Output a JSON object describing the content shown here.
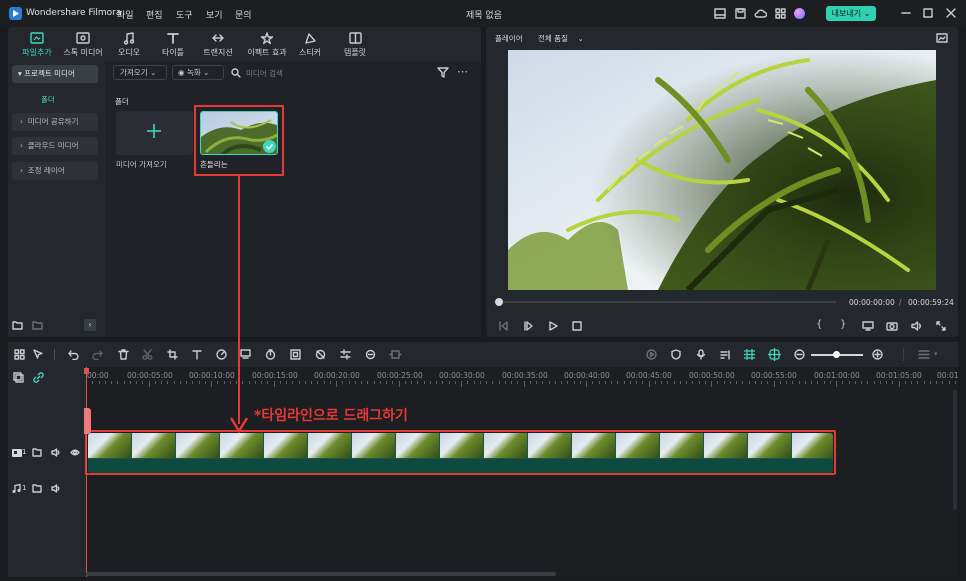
{
  "app": {
    "name": "Wondershare Filmora",
    "menus": [
      "파일",
      "편집",
      "도구",
      "보기",
      "문의"
    ],
    "project_title": "제목 없음",
    "export_label": "내보내기"
  },
  "media_tabs": [
    {
      "label": "파일추가",
      "icon": "import-icon",
      "active": true
    },
    {
      "label": "스톡 미디어",
      "icon": "stock-media-icon"
    },
    {
      "label": "오디오",
      "icon": "music-icon"
    },
    {
      "label": "타이틀",
      "icon": "title-icon"
    },
    {
      "label": "트랜지션",
      "icon": "transition-icon"
    },
    {
      "label": "이펙트 효과",
      "icon": "effects-icon"
    },
    {
      "label": "스티커",
      "icon": "sticker-icon"
    },
    {
      "label": "템플릿",
      "icon": "template-icon"
    }
  ],
  "sidebar": {
    "project_media": "프로젝트 미디어",
    "folder": "폴더",
    "items": [
      "미디어 공유하기",
      "클라우드 미디어",
      "조정 레이어"
    ]
  },
  "media": {
    "import_dropdown": "가져오기",
    "record_dropdown": "녹화",
    "search_placeholder": "미디어 검색",
    "folder_heading": "폴더",
    "import_tile_label": "미디어 가져오기",
    "clip_label": "흔들리는"
  },
  "player": {
    "label": "플레이어",
    "quality": "전체 품질",
    "current_time": "00:00:00:00",
    "separator": "/",
    "total_time": "00:00:59:24",
    "progress": 0.0
  },
  "timeline": {
    "ticks": [
      "00:00",
      "00:00:05:00",
      "00:00:10:00",
      "00:00:15:00",
      "00:00:20:00",
      "00:00:25:00",
      "00:00:30:00",
      "00:00:35:00",
      "00:00:40:00",
      "00:00:45:00",
      "00:00:50:00",
      "00:00:55:00",
      "00:01:00:00",
      "00:01:05:00",
      "00:01"
    ],
    "video_track_num": "1",
    "audio_track_num": "1"
  },
  "annotation": {
    "text": "*타임라인으로 드래그하기",
    "color": "#e53935"
  },
  "colors": {
    "accent": "#3fd7c0",
    "export_bg": "#2fd1b0",
    "playhead": "#e05252"
  }
}
